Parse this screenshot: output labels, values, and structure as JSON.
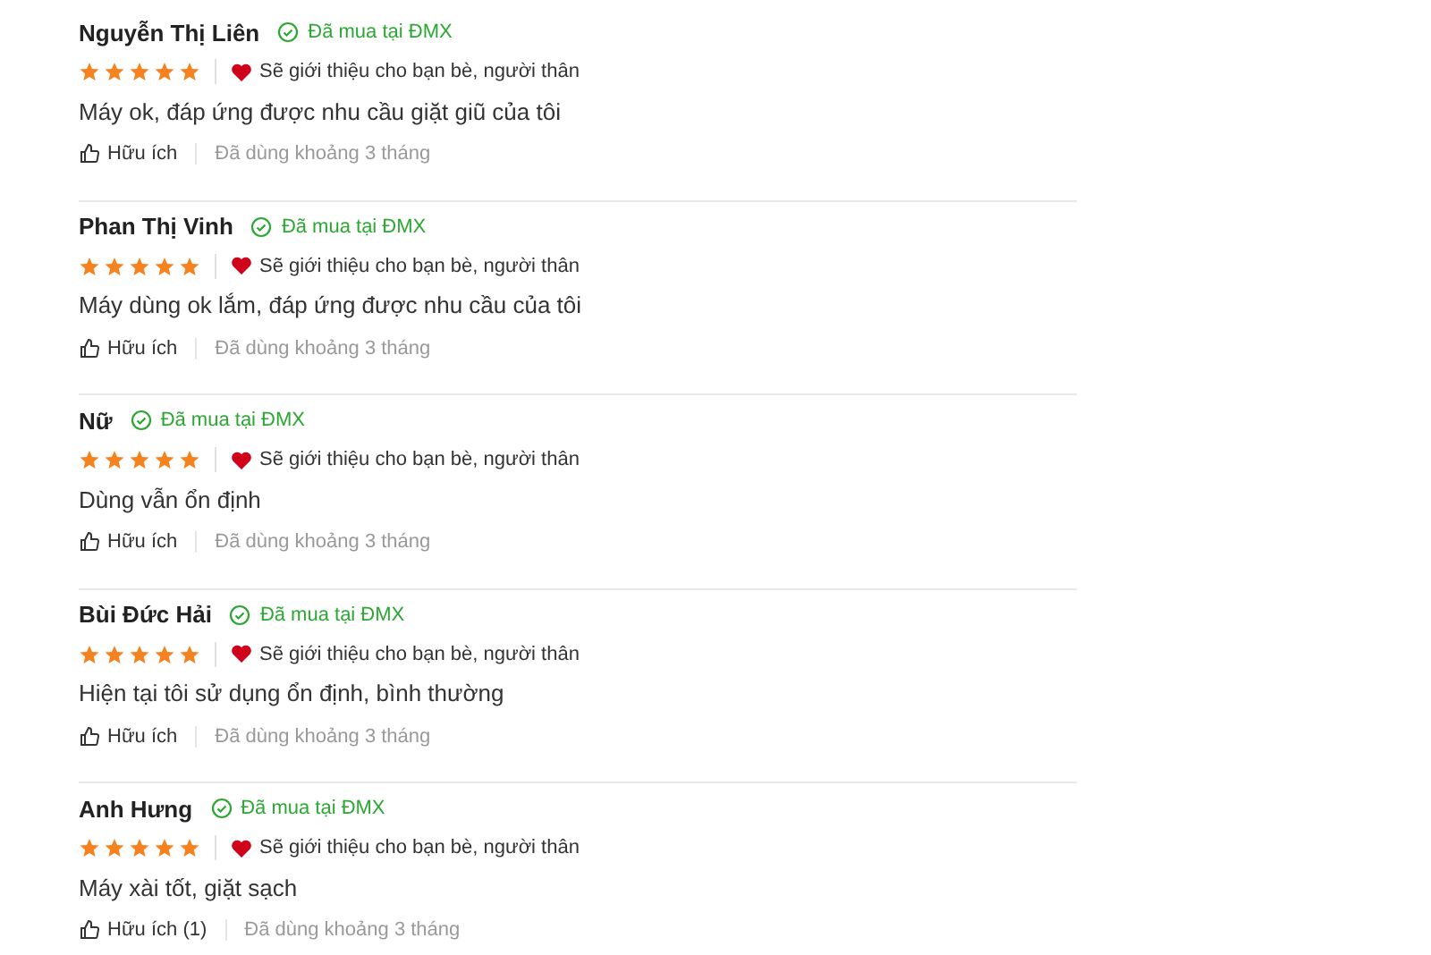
{
  "reviews": [
    {
      "name": "Nguyễn Thị Liên",
      "badge": "Đã mua tại ĐMX",
      "stars": 5,
      "recommend": "Sẽ giới thiệu cho bạn bè, người thân",
      "text": "Máy ok, đáp ứng được nhu cầu giặt giũ của tôi",
      "helpful": "Hữu ích",
      "usage": "Đã dùng khoảng 3 tháng"
    },
    {
      "name": "Phan Thị Vinh",
      "badge": "Đã mua tại ĐMX",
      "stars": 5,
      "recommend": "Sẽ giới thiệu cho bạn bè, người thân",
      "text": "Máy dùng ok lắm, đáp ứng được nhu cầu của tôi",
      "helpful": "Hữu ích",
      "usage": "Đã dùng khoảng 3 tháng"
    },
    {
      "name": "Nữ",
      "badge": "Đã mua tại ĐMX",
      "stars": 5,
      "recommend": "Sẽ giới thiệu cho bạn bè, người thân",
      "text": "Dùng vẫn ổn định",
      "helpful": "Hữu ích",
      "usage": "Đã dùng khoảng 3 tháng"
    },
    {
      "name": "Bùi Đức Hải",
      "badge": "Đã mua tại ĐMX",
      "stars": 5,
      "recommend": "Sẽ giới thiệu cho bạn bè, người thân",
      "text": "Hiện tại tôi sử dụng ổn định, bình thường",
      "helpful": "Hữu ích",
      "usage": "Đã dùng khoảng 3 tháng"
    },
    {
      "name": "Anh Hưng",
      "badge": "Đã mua tại ĐMX",
      "stars": 5,
      "recommend": "Sẽ giới thiệu cho bạn bè, người thân",
      "text": "Máy xài tốt, giặt sạch",
      "helpful": "Hữu ích (1)",
      "usage": "Đã dùng khoảng 3 tháng"
    }
  ]
}
